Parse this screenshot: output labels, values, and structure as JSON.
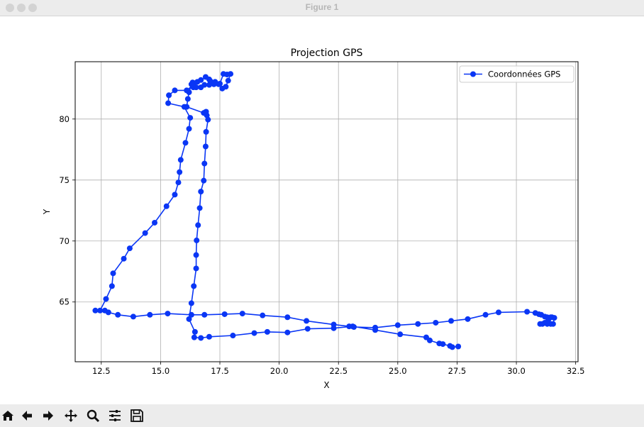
{
  "window": {
    "title": "Figure 1"
  },
  "toolbar": {
    "buttons": [
      "home-icon",
      "back-arrow-icon",
      "forward-arrow-icon",
      "pan-icon",
      "zoom-icon",
      "subplots-icon",
      "save-icon"
    ]
  },
  "chart_data": {
    "type": "line",
    "title": "Projection GPS",
    "xlabel": "X",
    "ylabel": "Y",
    "xlim": [
      11.4,
      32.6
    ],
    "ylim": [
      60.1,
      84.7
    ],
    "xticks": [
      "12.5",
      "15.0",
      "17.5",
      "20.0",
      "22.5",
      "25.0",
      "27.5",
      "30.0",
      "32.5"
    ],
    "xtick_values": [
      12.5,
      15.0,
      17.5,
      20.0,
      22.5,
      25.0,
      27.5,
      30.0,
      32.5
    ],
    "yticks": [
      "65",
      "70",
      "75",
      "80"
    ],
    "ytick_values": [
      65,
      70,
      75,
      80
    ],
    "grid": true,
    "legend": "top-right",
    "color": "#0a36f5",
    "series": [
      {
        "name": "Coordonnées GPS",
        "x": [
          27.55,
          27.3,
          27.2,
          26.9,
          26.75,
          26.35,
          26.2,
          25.1,
          24.05,
          23.1,
          22.3,
          21.2,
          20.35,
          19.5,
          18.95,
          18.05,
          17.05,
          16.7,
          16.42,
          16.45,
          16.2,
          16.3,
          16.4,
          16.5,
          16.5,
          16.52,
          16.58,
          16.65,
          16.7,
          16.82,
          16.85,
          16.9,
          16.92,
          17.0,
          16.95,
          16.92,
          16.88,
          16.82,
          16.1,
          16.15,
          16.2,
          16.3,
          16.35,
          16.4,
          16.38,
          16.4,
          16.55,
          16.7,
          16.9,
          17.05,
          17.1,
          17.3,
          17.45,
          17.6,
          17.75,
          17.85,
          17.95,
          17.8,
          17.65,
          17.5,
          17.25,
          17.05,
          16.85,
          16.7,
          16.5,
          16.35,
          16.1,
          15.6,
          15.35,
          15.32,
          16.0,
          16.25,
          16.2,
          16.05,
          15.85,
          15.8,
          15.75,
          15.6,
          15.25,
          14.75,
          14.35,
          13.7,
          13.45,
          13.0,
          12.95,
          12.7,
          12.45,
          12.25,
          12.65,
          12.8,
          13.2,
          13.85,
          14.55,
          15.3,
          16.3,
          16.85,
          17.7,
          18.45,
          19.3,
          20.35,
          21.15,
          22.3,
          22.95,
          23.15,
          24.05,
          25.0,
          25.85,
          26.6,
          27.25,
          27.95,
          28.7,
          29.25,
          30.45,
          30.8,
          30.95,
          31.05,
          31.2,
          31.3,
          31.35,
          31.45,
          31.6,
          31.55,
          31.45,
          31.3,
          31.1,
          31.0,
          31.2,
          31.35,
          31.5
        ],
        "y": [
          61.35,
          61.3,
          61.4,
          61.55,
          61.6,
          61.85,
          62.1,
          62.35,
          62.7,
          63.0,
          62.85,
          62.8,
          62.5,
          62.55,
          62.45,
          62.25,
          62.15,
          62.05,
          62.1,
          62.55,
          63.6,
          64.9,
          66.3,
          67.75,
          68.85,
          70.05,
          71.3,
          72.7,
          74.05,
          74.95,
          76.35,
          77.75,
          78.95,
          79.95,
          80.3,
          80.6,
          80.55,
          80.5,
          81.0,
          81.65,
          82.2,
          82.85,
          83.0,
          82.9,
          82.6,
          82.95,
          83.05,
          83.2,
          83.45,
          83.25,
          83.1,
          83.05,
          82.85,
          82.5,
          82.65,
          83.15,
          83.7,
          83.65,
          83.7,
          82.9,
          82.85,
          82.8,
          82.8,
          82.6,
          82.6,
          82.75,
          82.35,
          82.35,
          81.95,
          81.3,
          81.0,
          80.1,
          79.2,
          78.05,
          76.65,
          75.65,
          74.8,
          73.8,
          72.85,
          71.5,
          70.65,
          69.4,
          68.55,
          67.35,
          66.3,
          65.25,
          64.3,
          64.3,
          64.3,
          64.15,
          63.95,
          63.8,
          63.95,
          64.05,
          63.95,
          63.95,
          64.0,
          64.05,
          63.9,
          63.75,
          63.45,
          63.15,
          63.0,
          62.95,
          62.9,
          63.1,
          63.2,
          63.3,
          63.45,
          63.6,
          63.95,
          64.15,
          64.2,
          64.1,
          64.0,
          63.95,
          63.8,
          63.75,
          63.7,
          63.75,
          63.7,
          63.2,
          63.2,
          63.2,
          63.2,
          63.2,
          63.3,
          63.55,
          63.75
        ]
      }
    ]
  }
}
